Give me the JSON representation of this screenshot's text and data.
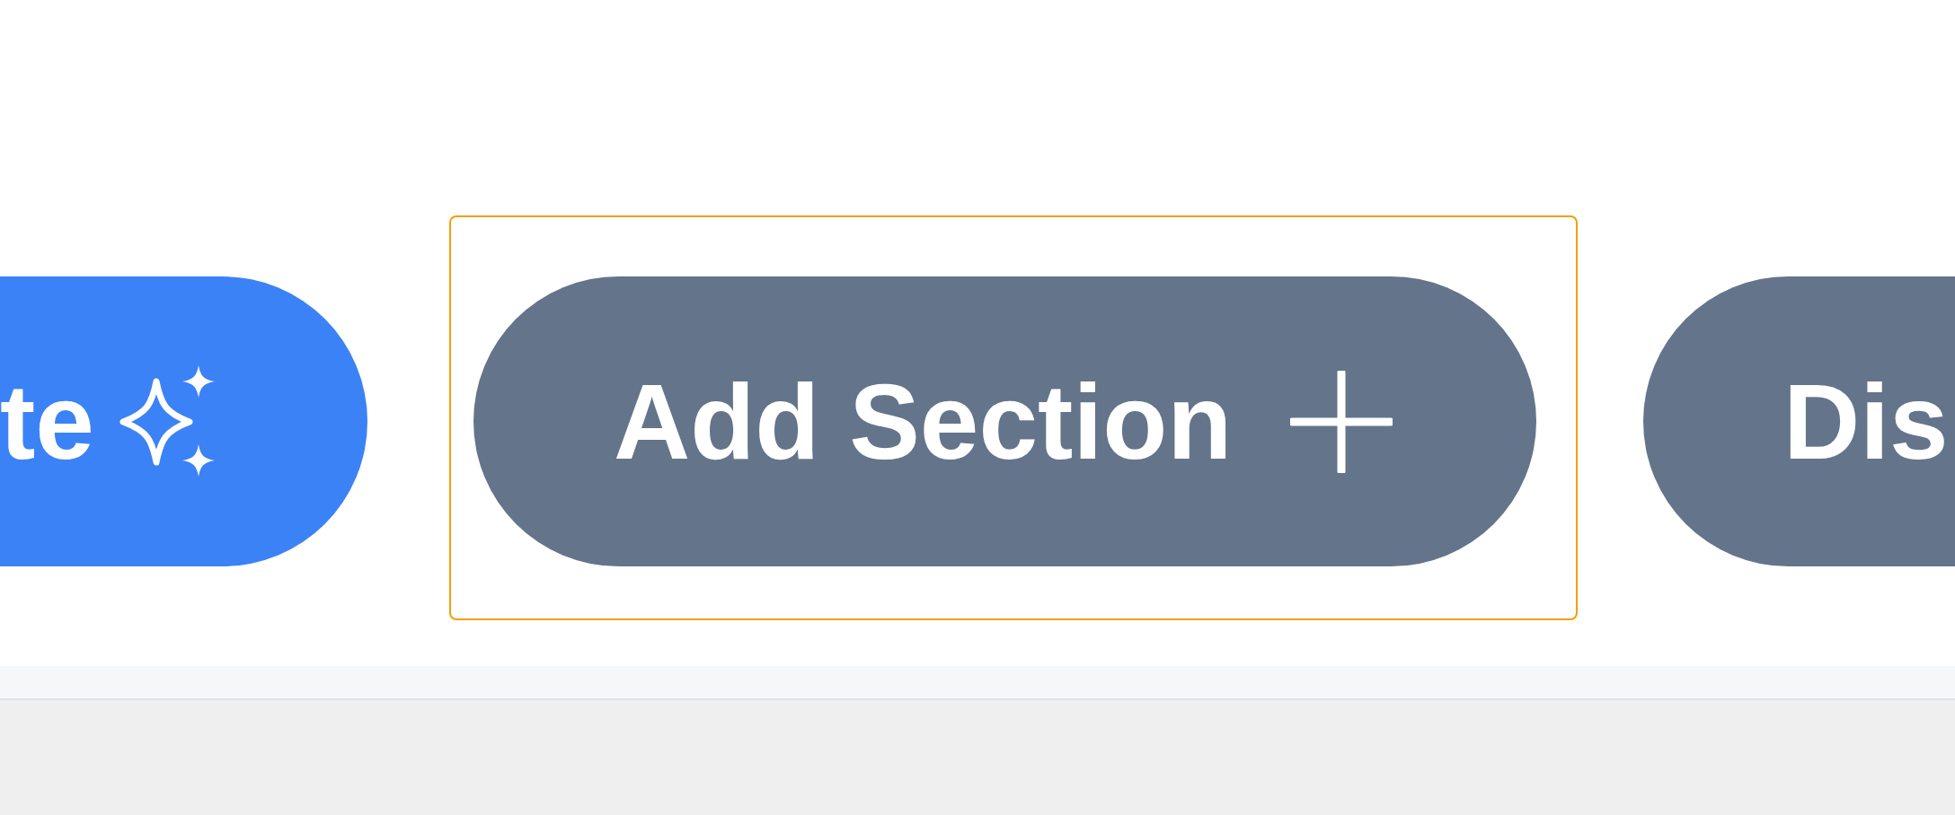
{
  "toolbar": {
    "buttons": [
      {
        "label": "te",
        "kind": "generate",
        "focused": false
      },
      {
        "label": "Add Section",
        "kind": "add",
        "focused": true
      },
      {
        "label": "Dis",
        "kind": "discard",
        "focused": false
      }
    ]
  }
}
